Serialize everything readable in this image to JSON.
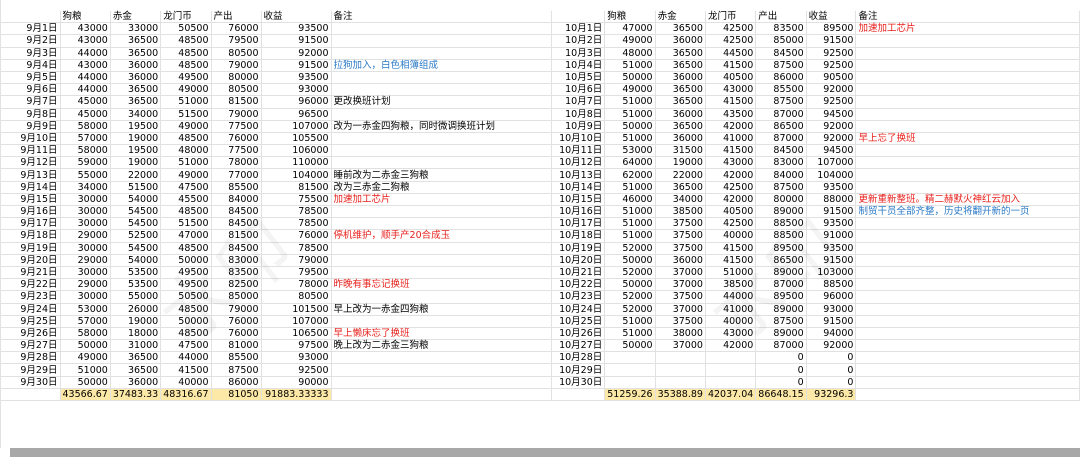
{
  "headers": [
    "",
    "狗粮",
    "赤金",
    "龙门币",
    "产出",
    "收益",
    "备注"
  ],
  "left": {
    "rows": [
      [
        "9月1日",
        "43000",
        "33000",
        "50500",
        "76000",
        "93500",
        ""
      ],
      [
        "9月2日",
        "43000",
        "36500",
        "48500",
        "79500",
        "91500",
        ""
      ],
      [
        "9月3日",
        "44000",
        "36500",
        "48500",
        "80500",
        "92000",
        ""
      ],
      [
        "9月4日",
        "43000",
        "36000",
        "48500",
        "79000",
        "91500",
        "拉狗加入，白色相簿组成"
      ],
      [
        "9月5日",
        "44000",
        "36000",
        "49500",
        "80000",
        "93500",
        ""
      ],
      [
        "9月6日",
        "44000",
        "36500",
        "49000",
        "80500",
        "93000",
        ""
      ],
      [
        "9月7日",
        "45000",
        "36500",
        "51000",
        "81500",
        "96000",
        "更改换班计划"
      ],
      [
        "9月8日",
        "45000",
        "34000",
        "51500",
        "79000",
        "96500",
        ""
      ],
      [
        "9月9日",
        "58000",
        "19500",
        "49000",
        "77500",
        "107000",
        "改为一赤金四狗粮，同时微调换班计划"
      ],
      [
        "9月10日",
        "57000",
        "19000",
        "48500",
        "76000",
        "105500",
        ""
      ],
      [
        "9月11日",
        "58000",
        "19500",
        "48000",
        "77500",
        "106000",
        ""
      ],
      [
        "9月12日",
        "59000",
        "19000",
        "51000",
        "78000",
        "110000",
        ""
      ],
      [
        "9月13日",
        "55000",
        "22000",
        "49000",
        "77000",
        "104000",
        "睡前改为二赤金三狗粮"
      ],
      [
        "9月14日",
        "34000",
        "51500",
        "47500",
        "85500",
        "81500",
        "改为三赤金二狗粮"
      ],
      [
        "9月15日",
        "30000",
        "54000",
        "45500",
        "84000",
        "75500",
        "加速加工芯片"
      ],
      [
        "9月16日",
        "30000",
        "54500",
        "48500",
        "84500",
        "78500",
        ""
      ],
      [
        "9月17日",
        "30000",
        "54500",
        "51500",
        "84500",
        "78500",
        ""
      ],
      [
        "9月18日",
        "29000",
        "52500",
        "47000",
        "81500",
        "76000",
        "停机维护，顺手产20合成玉"
      ],
      [
        "9月19日",
        "30000",
        "54500",
        "48500",
        "84500",
        "78500",
        ""
      ],
      [
        "9月20日",
        "29000",
        "54000",
        "50000",
        "83000",
        "79000",
        ""
      ],
      [
        "9月21日",
        "30000",
        "53500",
        "49500",
        "83500",
        "79500",
        ""
      ],
      [
        "9月22日",
        "29000",
        "53500",
        "49500",
        "82500",
        "78000",
        "昨晚有事忘记换班"
      ],
      [
        "9月23日",
        "30000",
        "55000",
        "50500",
        "85000",
        "80500",
        ""
      ],
      [
        "9月24日",
        "53000",
        "26000",
        "48500",
        "79000",
        "101500",
        "早上改为一赤金四狗粮"
      ],
      [
        "9月25日",
        "57000",
        "19000",
        "50000",
        "76000",
        "107000",
        ""
      ],
      [
        "9月26日",
        "58000",
        "18000",
        "48500",
        "76000",
        "106500",
        "早上懒床忘了换班"
      ],
      [
        "9月27日",
        "50000",
        "31000",
        "47500",
        "81000",
        "97500",
        "晚上改为二赤金三狗粮"
      ],
      [
        "9月28日",
        "49000",
        "36500",
        "44000",
        "85500",
        "93000",
        ""
      ],
      [
        "9月29日",
        "51000",
        "36500",
        "41500",
        "87500",
        "92500",
        ""
      ],
      [
        "9月30日",
        "50000",
        "36000",
        "40000",
        "86000",
        "90000",
        ""
      ]
    ],
    "note_colors": {
      "3": "blue",
      "6": "black",
      "8": "black",
      "12": "black",
      "13": "black",
      "14": "red",
      "17": "red",
      "21": "red",
      "23": "black",
      "25": "red",
      "26": "black"
    },
    "averages": [
      "43566.67",
      "37483.33",
      "48316.67",
      "81050",
      "91883.33333"
    ]
  },
  "right": {
    "rows": [
      [
        "10月1日",
        "47000",
        "36500",
        "42500",
        "83500",
        "89500",
        "加速加工芯片"
      ],
      [
        "10月2日",
        "49000",
        "36000",
        "42500",
        "85000",
        "91500",
        ""
      ],
      [
        "10月3日",
        "48000",
        "36500",
        "44500",
        "84500",
        "92500",
        ""
      ],
      [
        "10月4日",
        "51000",
        "36500",
        "41500",
        "87500",
        "92500",
        ""
      ],
      [
        "10月5日",
        "50000",
        "36000",
        "40500",
        "86000",
        "90500",
        ""
      ],
      [
        "10月6日",
        "49000",
        "36500",
        "43000",
        "85500",
        "92000",
        ""
      ],
      [
        "10月7日",
        "51000",
        "36500",
        "41500",
        "87500",
        "92500",
        ""
      ],
      [
        "10月8日",
        "51000",
        "36000",
        "43500",
        "87000",
        "94500",
        ""
      ],
      [
        "10月9日",
        "50000",
        "36500",
        "42000",
        "86500",
        "92000",
        ""
      ],
      [
        "10月10日",
        "51000",
        "36000",
        "41000",
        "87000",
        "92000",
        "早上忘了换班"
      ],
      [
        "10月11日",
        "53000",
        "31500",
        "41500",
        "84500",
        "94500",
        ""
      ],
      [
        "10月12日",
        "64000",
        "19000",
        "43000",
        "83000",
        "107000",
        ""
      ],
      [
        "10月13日",
        "62000",
        "22000",
        "42000",
        "84000",
        "104000",
        ""
      ],
      [
        "10月14日",
        "51000",
        "36500",
        "42500",
        "87500",
        "93500",
        ""
      ],
      [
        "10月15日",
        "46000",
        "34000",
        "42000",
        "80000",
        "88000",
        "更新重新整班。精二赫默火神红云加入"
      ],
      [
        "10月16日",
        "51000",
        "38500",
        "40500",
        "89000",
        "91500",
        "制贸干员全部齐整，历史将翻开新的一页"
      ],
      [
        "10月17日",
        "51000",
        "37500",
        "42500",
        "88500",
        "93500",
        ""
      ],
      [
        "10月18日",
        "51000",
        "37500",
        "40000",
        "88500",
        "91000",
        ""
      ],
      [
        "10月19日",
        "52000",
        "37500",
        "41500",
        "89500",
        "93500",
        ""
      ],
      [
        "10月20日",
        "50000",
        "36000",
        "41500",
        "86500",
        "91500",
        ""
      ],
      [
        "10月21日",
        "52000",
        "37000",
        "51000",
        "89000",
        "103000",
        ""
      ],
      [
        "10月22日",
        "50000",
        "37000",
        "38500",
        "87000",
        "88500",
        ""
      ],
      [
        "10月23日",
        "52000",
        "37500",
        "44000",
        "89500",
        "96000",
        ""
      ],
      [
        "10月24日",
        "52000",
        "37000",
        "41000",
        "89000",
        "93000",
        ""
      ],
      [
        "10月25日",
        "51000",
        "37500",
        "40000",
        "87500",
        "91500",
        ""
      ],
      [
        "10月26日",
        "51000",
        "38000",
        "43000",
        "89000",
        "94000",
        ""
      ],
      [
        "10月27日",
        "50000",
        "37000",
        "42000",
        "87000",
        "92000",
        ""
      ],
      [
        "10月28日",
        "",
        "",
        "",
        "0",
        "0",
        ""
      ],
      [
        "10月29日",
        "",
        "",
        "",
        "0",
        "0",
        ""
      ],
      [
        "10月30日",
        "",
        "",
        "",
        "0",
        "0",
        ""
      ]
    ],
    "note_colors": {
      "0": "red",
      "9": "red",
      "14": "red",
      "15": "blue"
    },
    "averages": [
      "51259.26",
      "35388.89",
      "42037.04",
      "86648.15",
      "93296.3"
    ]
  }
}
